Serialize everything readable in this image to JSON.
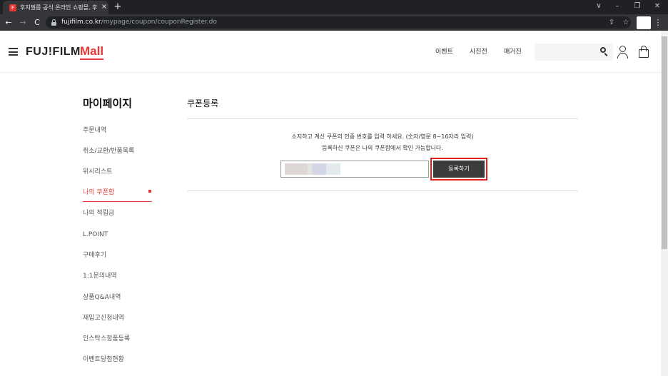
{
  "browser": {
    "tab_icon_letter": "F",
    "tab_title": "후지필름 공식 온라인 쇼핑몰, 후",
    "tab_close": "×",
    "new_tab": "+",
    "nav_back": "←",
    "nav_forward": "→",
    "nav_reload": "C",
    "url_host": "fujifilm.co.kr",
    "url_path": "/mypage/coupon/couponRegister.do",
    "share_icon": "⇪",
    "bookmark_icon": "☆",
    "menu_icon": "⋮",
    "win_min": "–",
    "win_restore": "❐",
    "win_close": "✕",
    "win_collapse": "∨"
  },
  "header": {
    "logo_text": "FUJ!FILM",
    "logo_mall": "Mall",
    "gnb": [
      "이벤트",
      "사진전",
      "매거진"
    ],
    "brand_color": "#e53935"
  },
  "sidebar": {
    "title": "마이페이지",
    "items": [
      {
        "label": "주문내역"
      },
      {
        "label": "취소/교환/반품목록"
      },
      {
        "label": "위시리스트"
      },
      {
        "label": "나의 쿠폰함",
        "active": true
      },
      {
        "label": "나의 적립금"
      },
      {
        "label": "L.POINT"
      },
      {
        "label": "구매후기"
      },
      {
        "label": "1:1문의내역"
      },
      {
        "label": "상품Q&A내역"
      },
      {
        "label": "재입고신청내역"
      },
      {
        "label": "인스탁스정품등록"
      },
      {
        "label": "이벤트당첨현황"
      }
    ]
  },
  "main": {
    "title": "쿠폰등록",
    "notice_line1": "소지하고 계신 쿠폰의 인증 번호를 입력 하세요. (숫자/영문 8~16자리 입력)",
    "notice_line2": "등록하신 쿠폰은 나의 쿠폰함에서 확인 가능합니다.",
    "register_label": "등록하기"
  }
}
